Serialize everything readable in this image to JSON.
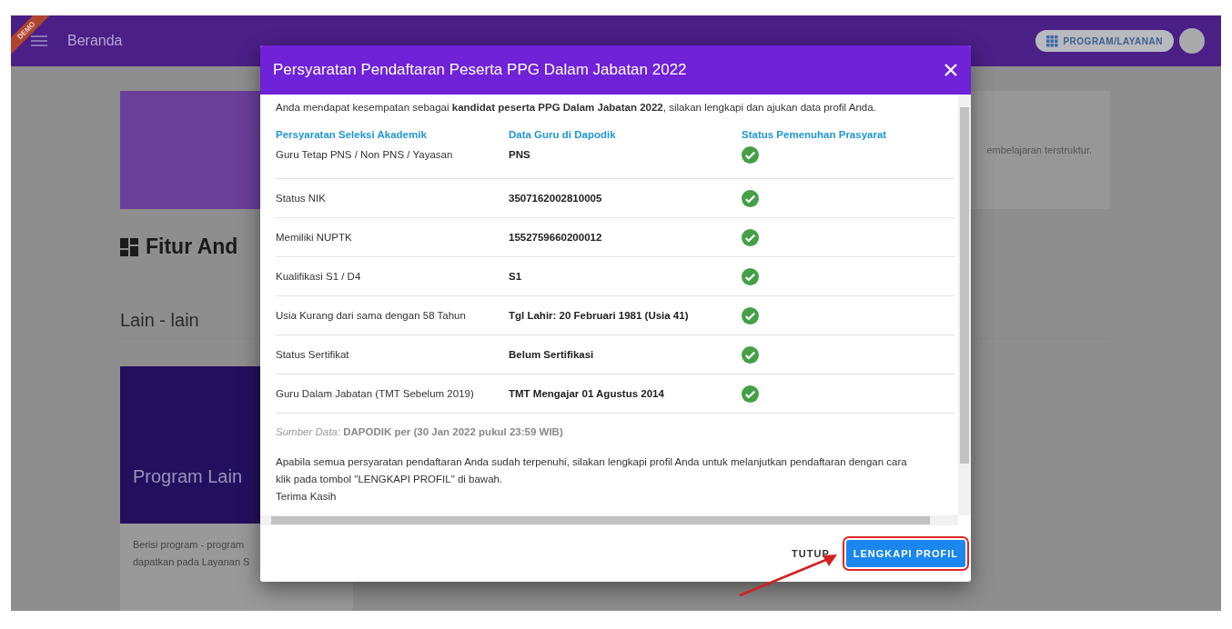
{
  "topbar": {
    "ribbon": "DEMO",
    "title": "Beranda",
    "program_button": "PROGRAM/LAYANAN"
  },
  "background": {
    "hero_text": "embelajaran terstruktur.",
    "features_heading": "Fitur And",
    "others_heading": "Lain - lain",
    "program_card": {
      "title": "Program Lain",
      "description": [
        "Berisi program - program",
        "dapatkan pada Layanan S"
      ]
    }
  },
  "dialog": {
    "title": "Persyaratan Pendaftaran Peserta PPG Dalam Jabatan 2022",
    "intro": "Anda mendapat kesempatan sebagai **kandidat peserta PPG Dalam Jabatan 2022**, silakan lengkapi dan ajukan data profil Anda.",
    "columns": [
      "Persyaratan Seleksi Akademik",
      "Data Guru di Dapodik",
      "Status Pemenuhan Prasyarat"
    ],
    "rows": [
      {
        "requirement": "Guru Tetap PNS / Non PNS / Yayasan",
        "value": "PNS",
        "met": true
      },
      {
        "requirement": "Status NIK",
        "value": "3507162002810005",
        "met": true
      },
      {
        "requirement": "Memiliki NUPTK",
        "value": "1552759660200012",
        "met": true
      },
      {
        "requirement": "Kualifikasi S1 / D4",
        "value": "S1",
        "met": true
      },
      {
        "requirement": "Usia Kurang dari sama dengan 58 Tahun",
        "value": "Tgl Lahir: 20 Februari 1981 (Usia 41)",
        "met": true
      },
      {
        "requirement": "Status Sertifikat",
        "value": "Belum Sertifikasi",
        "met": true
      },
      {
        "requirement": "Guru Dalam Jabatan (TMT Sebelum 2019)",
        "value": "TMT Mengajar 01 Agustus 2014",
        "met": true
      }
    ],
    "source": "*Sumber Data:* **DAPODIK per (30 Jan 2022 pukul 23:59 WIB)**",
    "note": "Apabila semua persyaratan pendaftaran Anda sudah terpenuhi, silakan lengkapi profil Anda untuk melanjutkan pendaftaran dengan cara klik pada tombol \"LENGKAPI PROFIL\" di bawah.",
    "closing": "Terima Kasih",
    "buttons": [
      {
        "label": "TUTUP",
        "kind": "text"
      },
      {
        "label": "LENGKAPI PROFIL",
        "kind": "primary",
        "highlighted": true
      }
    ]
  }
}
